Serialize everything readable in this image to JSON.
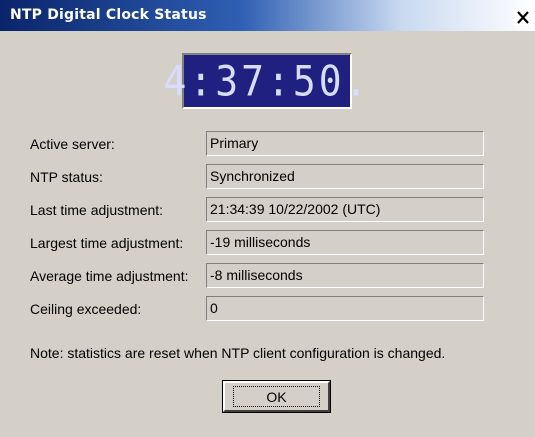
{
  "window": {
    "title": "NTP Digital Clock Status",
    "close_icon": "close-icon"
  },
  "clock": {
    "time": "4:37:50."
  },
  "rows": [
    {
      "label": "Active server:",
      "value": "Primary"
    },
    {
      "label": "NTP status:",
      "value": "Synchronized"
    },
    {
      "label": "Last time adjustment:",
      "value": "21:34:39 10/22/2002 (UTC)"
    },
    {
      "label": "Largest time adjustment:",
      "value": "-19 milliseconds"
    },
    {
      "label": "Average time adjustment:",
      "value": "-8 milliseconds"
    },
    {
      "label": "Ceiling exceeded:",
      "value": "0"
    }
  ],
  "note": "Note: statistics are reset when NTP client configuration is changed.",
  "ok_button": {
    "label": "OK"
  },
  "colors": {
    "titlebar_start": "#0a246a",
    "dialog_background": "#d4d0c8",
    "clock_background": "#202080",
    "clock_digits": "#d8dcff"
  }
}
